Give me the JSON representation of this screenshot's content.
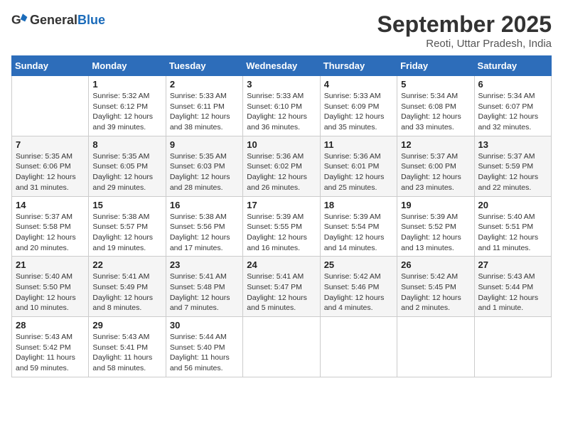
{
  "header": {
    "logo_general": "General",
    "logo_blue": "Blue",
    "month": "September 2025",
    "location": "Reoti, Uttar Pradesh, India"
  },
  "days_of_week": [
    "Sunday",
    "Monday",
    "Tuesday",
    "Wednesday",
    "Thursday",
    "Friday",
    "Saturday"
  ],
  "weeks": [
    [
      {
        "day": "",
        "info": ""
      },
      {
        "day": "1",
        "info": "Sunrise: 5:32 AM\nSunset: 6:12 PM\nDaylight: 12 hours\nand 39 minutes."
      },
      {
        "day": "2",
        "info": "Sunrise: 5:33 AM\nSunset: 6:11 PM\nDaylight: 12 hours\nand 38 minutes."
      },
      {
        "day": "3",
        "info": "Sunrise: 5:33 AM\nSunset: 6:10 PM\nDaylight: 12 hours\nand 36 minutes."
      },
      {
        "day": "4",
        "info": "Sunrise: 5:33 AM\nSunset: 6:09 PM\nDaylight: 12 hours\nand 35 minutes."
      },
      {
        "day": "5",
        "info": "Sunrise: 5:34 AM\nSunset: 6:08 PM\nDaylight: 12 hours\nand 33 minutes."
      },
      {
        "day": "6",
        "info": "Sunrise: 5:34 AM\nSunset: 6:07 PM\nDaylight: 12 hours\nand 32 minutes."
      }
    ],
    [
      {
        "day": "7",
        "info": "Sunrise: 5:35 AM\nSunset: 6:06 PM\nDaylight: 12 hours\nand 31 minutes."
      },
      {
        "day": "8",
        "info": "Sunrise: 5:35 AM\nSunset: 6:05 PM\nDaylight: 12 hours\nand 29 minutes."
      },
      {
        "day": "9",
        "info": "Sunrise: 5:35 AM\nSunset: 6:03 PM\nDaylight: 12 hours\nand 28 minutes."
      },
      {
        "day": "10",
        "info": "Sunrise: 5:36 AM\nSunset: 6:02 PM\nDaylight: 12 hours\nand 26 minutes."
      },
      {
        "day": "11",
        "info": "Sunrise: 5:36 AM\nSunset: 6:01 PM\nDaylight: 12 hours\nand 25 minutes."
      },
      {
        "day": "12",
        "info": "Sunrise: 5:37 AM\nSunset: 6:00 PM\nDaylight: 12 hours\nand 23 minutes."
      },
      {
        "day": "13",
        "info": "Sunrise: 5:37 AM\nSunset: 5:59 PM\nDaylight: 12 hours\nand 22 minutes."
      }
    ],
    [
      {
        "day": "14",
        "info": "Sunrise: 5:37 AM\nSunset: 5:58 PM\nDaylight: 12 hours\nand 20 minutes."
      },
      {
        "day": "15",
        "info": "Sunrise: 5:38 AM\nSunset: 5:57 PM\nDaylight: 12 hours\nand 19 minutes."
      },
      {
        "day": "16",
        "info": "Sunrise: 5:38 AM\nSunset: 5:56 PM\nDaylight: 12 hours\nand 17 minutes."
      },
      {
        "day": "17",
        "info": "Sunrise: 5:39 AM\nSunset: 5:55 PM\nDaylight: 12 hours\nand 16 minutes."
      },
      {
        "day": "18",
        "info": "Sunrise: 5:39 AM\nSunset: 5:54 PM\nDaylight: 12 hours\nand 14 minutes."
      },
      {
        "day": "19",
        "info": "Sunrise: 5:39 AM\nSunset: 5:52 PM\nDaylight: 12 hours\nand 13 minutes."
      },
      {
        "day": "20",
        "info": "Sunrise: 5:40 AM\nSunset: 5:51 PM\nDaylight: 12 hours\nand 11 minutes."
      }
    ],
    [
      {
        "day": "21",
        "info": "Sunrise: 5:40 AM\nSunset: 5:50 PM\nDaylight: 12 hours\nand 10 minutes."
      },
      {
        "day": "22",
        "info": "Sunrise: 5:41 AM\nSunset: 5:49 PM\nDaylight: 12 hours\nand 8 minutes."
      },
      {
        "day": "23",
        "info": "Sunrise: 5:41 AM\nSunset: 5:48 PM\nDaylight: 12 hours\nand 7 minutes."
      },
      {
        "day": "24",
        "info": "Sunrise: 5:41 AM\nSunset: 5:47 PM\nDaylight: 12 hours\nand 5 minutes."
      },
      {
        "day": "25",
        "info": "Sunrise: 5:42 AM\nSunset: 5:46 PM\nDaylight: 12 hours\nand 4 minutes."
      },
      {
        "day": "26",
        "info": "Sunrise: 5:42 AM\nSunset: 5:45 PM\nDaylight: 12 hours\nand 2 minutes."
      },
      {
        "day": "27",
        "info": "Sunrise: 5:43 AM\nSunset: 5:44 PM\nDaylight: 12 hours\nand 1 minute."
      }
    ],
    [
      {
        "day": "28",
        "info": "Sunrise: 5:43 AM\nSunset: 5:42 PM\nDaylight: 11 hours\nand 59 minutes."
      },
      {
        "day": "29",
        "info": "Sunrise: 5:43 AM\nSunset: 5:41 PM\nDaylight: 11 hours\nand 58 minutes."
      },
      {
        "day": "30",
        "info": "Sunrise: 5:44 AM\nSunset: 5:40 PM\nDaylight: 11 hours\nand 56 minutes."
      },
      {
        "day": "",
        "info": ""
      },
      {
        "day": "",
        "info": ""
      },
      {
        "day": "",
        "info": ""
      },
      {
        "day": "",
        "info": ""
      }
    ]
  ]
}
